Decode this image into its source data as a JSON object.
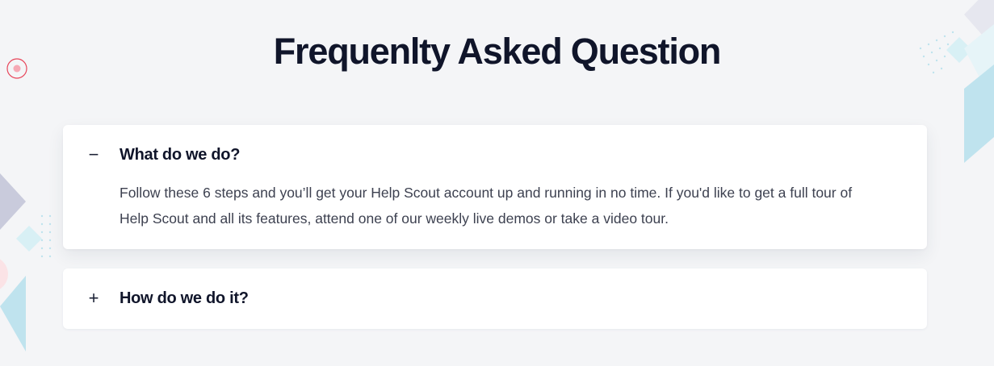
{
  "heading": "Frequenlty Asked Question",
  "colors": {
    "background": "#f4f5f7",
    "card": "#ffffff",
    "heading": "#10152a",
    "body_text": "#3d4150",
    "deco_red": "#e8455a",
    "deco_blue": "#bfe3ee",
    "deco_lavender": "#c9cbdc"
  },
  "faq": [
    {
      "expanded": true,
      "toggle_icon": "minus-icon",
      "toggle_glyph": "−",
      "question": "What do we do?",
      "answer": "Follow these 6 steps and you’ll get your Help Scout account up and running in no time. If you'd like to get a full tour of Help Scout and all its features, attend one of our weekly live demos or take a video tour."
    },
    {
      "expanded": false,
      "toggle_icon": "plus-icon",
      "toggle_glyph": "+",
      "question": "How do we do it?"
    }
  ]
}
